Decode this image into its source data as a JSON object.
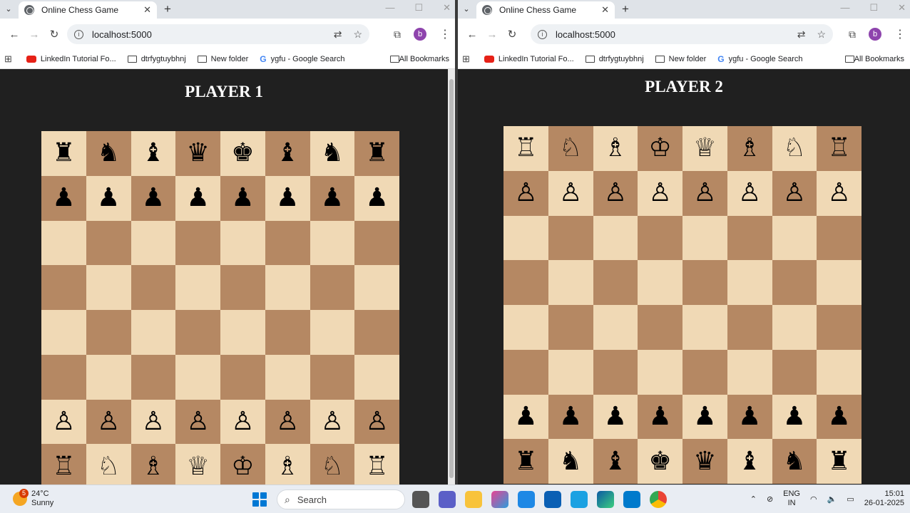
{
  "windows": [
    {
      "tab_title": "Online Chess Game",
      "url": "localhost:5000",
      "profile_initial": "b",
      "bookmarks": [
        "LinkedIn Tutorial Fo...",
        "dtrfygtuybhnj",
        "New folder",
        "ygfu - Google Search"
      ],
      "all_bookmarks": "All Bookmarks",
      "heading": "PLAYER 1",
      "board": [
        [
          "♜",
          "♞",
          "♝",
          "♛",
          "♚",
          "♝",
          "♞",
          "♜"
        ],
        [
          "♟",
          "♟",
          "♟",
          "♟",
          "♟",
          "♟",
          "♟",
          "♟"
        ],
        [
          "",
          "",
          "",
          "",
          "",
          "",
          "",
          ""
        ],
        [
          "",
          "",
          "",
          "",
          "",
          "",
          "",
          ""
        ],
        [
          "",
          "",
          "",
          "",
          "",
          "",
          "",
          ""
        ],
        [
          "",
          "",
          "",
          "",
          "",
          "",
          "",
          ""
        ],
        [
          "♙",
          "♙",
          "♙",
          "♙",
          "♙",
          "♙",
          "♙",
          "♙"
        ],
        [
          "♖",
          "♘",
          "♗",
          "♕",
          "♔",
          "♗",
          "♘",
          "♖"
        ]
      ]
    },
    {
      "tab_title": "Online Chess Game",
      "url": "localhost:5000",
      "profile_initial": "b",
      "bookmarks": [
        "LinkedIn Tutorial Fo...",
        "dtrfygtuybhnj",
        "New folder",
        "ygfu - Google Search"
      ],
      "all_bookmarks": "All Bookmarks",
      "heading": "PLAYER 2",
      "board": [
        [
          "♖",
          "♘",
          "♗",
          "♔",
          "♕",
          "♗",
          "♘",
          "♖"
        ],
        [
          "♙",
          "♙",
          "♙",
          "♙",
          "♙",
          "♙",
          "♙",
          "♙"
        ],
        [
          "",
          "",
          "",
          "",
          "",
          "",
          "",
          ""
        ],
        [
          "",
          "",
          "",
          "",
          "",
          "",
          "",
          ""
        ],
        [
          "",
          "",
          "",
          "",
          "",
          "",
          "",
          ""
        ],
        [
          "",
          "",
          "",
          "",
          "",
          "",
          "",
          ""
        ],
        [
          "♟",
          "♟",
          "♟",
          "♟",
          "♟",
          "♟",
          "♟",
          "♟"
        ],
        [
          "♜",
          "♞",
          "♝",
          "♚",
          "♛",
          "♝",
          "♞",
          "♜"
        ]
      ]
    }
  ],
  "board_colors": {
    "light": "#f0d9b5",
    "dark": "#b58863"
  },
  "taskbar": {
    "weather_badge": "5",
    "temperature": "24°C",
    "condition": "Sunny",
    "search_placeholder": "Search",
    "lang_line1": "ENG",
    "lang_line2": "IN",
    "time": "15:01",
    "date": "26-01-2025"
  }
}
